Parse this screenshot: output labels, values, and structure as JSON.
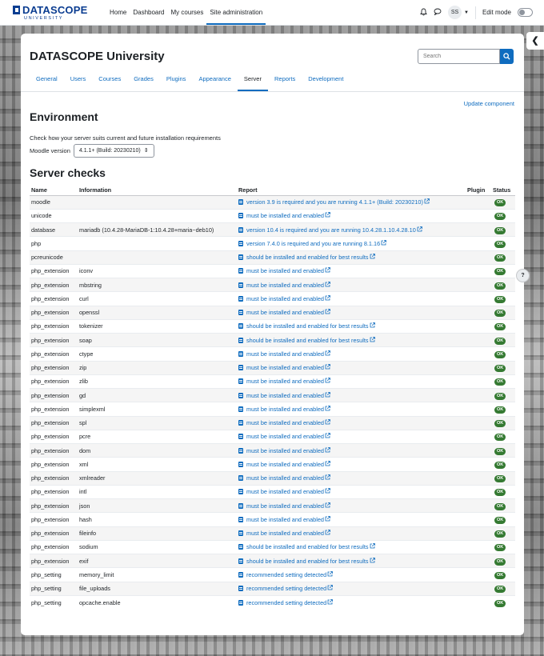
{
  "navbar": {
    "brand": "DATASCOPE",
    "brand_sub": "UNIVERSITY",
    "primary_nav": [
      "Home",
      "Dashboard",
      "My courses",
      "Site administration"
    ],
    "avatar_initials": "SS",
    "edit_mode_label": "Edit mode",
    "edit_mode_on": false
  },
  "help_label": "?",
  "page": {
    "site_title": "DATASCOPE University",
    "search_placeholder": "Search",
    "tabs": [
      "General",
      "Users",
      "Courses",
      "Grades",
      "Plugins",
      "Appearance",
      "Server",
      "Reports",
      "Development"
    ],
    "active_tab": "Server",
    "update_link": "Update component",
    "env_heading": "Environment",
    "env_description": "Check how your server suits current and future installation requirements",
    "moodle_version_label": "Moodle version",
    "moodle_version_value": "4.1.1+ (Build: 20230210)",
    "checks_heading": "Server checks"
  },
  "table": {
    "headers": [
      "Name",
      "Information",
      "Report",
      "Plugin",
      "Status"
    ],
    "status_label": "OK",
    "rows": [
      {
        "name": "moodle",
        "info": "",
        "report": "version 3.9 is required and you are running 4.1.1+ (Build: 20230210)"
      },
      {
        "name": "unicode",
        "info": "",
        "report": "must be installed and enabled"
      },
      {
        "name": "database",
        "info": "mariadb (10.4.28-MariaDB-1:10.4.28+maria~deb10)",
        "report": "version 10.4 is required and you are running 10.4.28.1.10.4.28.10"
      },
      {
        "name": "php",
        "info": "",
        "report": "version 7.4.0 is required and you are running 8.1.16"
      },
      {
        "name": "pcreunicode",
        "info": "",
        "report": "should be installed and enabled for best results"
      },
      {
        "name": "php_extension",
        "info": "iconv",
        "report": "must be installed and enabled"
      },
      {
        "name": "php_extension",
        "info": "mbstring",
        "report": "must be installed and enabled"
      },
      {
        "name": "php_extension",
        "info": "curl",
        "report": "must be installed and enabled"
      },
      {
        "name": "php_extension",
        "info": "openssl",
        "report": "must be installed and enabled"
      },
      {
        "name": "php_extension",
        "info": "tokenizer",
        "report": "should be installed and enabled for best results"
      },
      {
        "name": "php_extension",
        "info": "soap",
        "report": "should be installed and enabled for best results"
      },
      {
        "name": "php_extension",
        "info": "ctype",
        "report": "must be installed and enabled"
      },
      {
        "name": "php_extension",
        "info": "zip",
        "report": "must be installed and enabled"
      },
      {
        "name": "php_extension",
        "info": "zlib",
        "report": "must be installed and enabled"
      },
      {
        "name": "php_extension",
        "info": "gd",
        "report": "must be installed and enabled"
      },
      {
        "name": "php_extension",
        "info": "simplexml",
        "report": "must be installed and enabled"
      },
      {
        "name": "php_extension",
        "info": "spl",
        "report": "must be installed and enabled"
      },
      {
        "name": "php_extension",
        "info": "pcre",
        "report": "must be installed and enabled"
      },
      {
        "name": "php_extension",
        "info": "dom",
        "report": "must be installed and enabled"
      },
      {
        "name": "php_extension",
        "info": "xml",
        "report": "must be installed and enabled"
      },
      {
        "name": "php_extension",
        "info": "xmlreader",
        "report": "must be installed and enabled"
      },
      {
        "name": "php_extension",
        "info": "intl",
        "report": "must be installed and enabled"
      },
      {
        "name": "php_extension",
        "info": "json",
        "report": "must be installed and enabled"
      },
      {
        "name": "php_extension",
        "info": "hash",
        "report": "must be installed and enabled"
      },
      {
        "name": "php_extension",
        "info": "fileinfo",
        "report": "must be installed and enabled"
      },
      {
        "name": "php_extension",
        "info": "sodium",
        "report": "should be installed and enabled for best results"
      },
      {
        "name": "php_extension",
        "info": "exif",
        "report": "should be installed and enabled for best results"
      },
      {
        "name": "php_setting",
        "info": "memory_limit",
        "report": "recommended setting detected"
      },
      {
        "name": "php_setting",
        "info": "file_uploads",
        "report": "recommended setting detected"
      },
      {
        "name": "php_setting",
        "info": "opcache.enable",
        "report": "recommended setting detected"
      }
    ]
  },
  "colors": {
    "accent": "#0f6cbf",
    "brand": "#0b3d91",
    "ok_badge": "#357a32"
  },
  "icons": {
    "notifications": "bell-icon",
    "messages": "chat-icon",
    "drawer": "chevron-left-icon",
    "search": "search-icon",
    "report_doc": "document-icon",
    "external_link": "external-link-icon"
  }
}
